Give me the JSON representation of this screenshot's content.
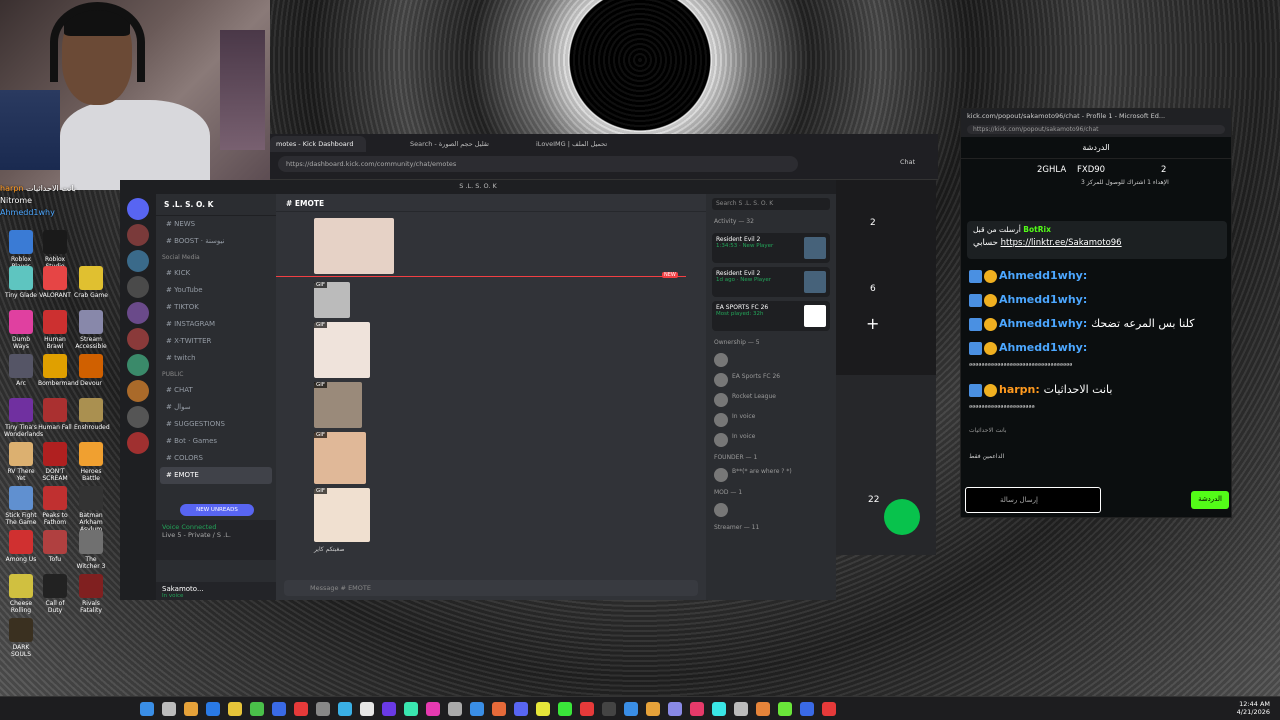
{
  "overlay_chat": {
    "rows": [
      {
        "user": "harpn",
        "text": "بانت الاحداثيات"
      },
      {
        "user": "",
        "text": "Nitrome"
      },
      {
        "user": "",
        "text": "Ahmedd1why"
      }
    ]
  },
  "desktop_icons": [
    {
      "label": "Roblox Player",
      "color": "#3a7bd5"
    },
    {
      "label": "Roblox Studio",
      "color": "#1a1a1a"
    },
    {
      "label": "Tiny Glade",
      "color": "#5ec5c0"
    },
    {
      "label": "VALORANT",
      "color": "#e64545"
    },
    {
      "label": "Crab Game",
      "color": "#e0c030"
    },
    {
      "label": "Dumb Ways",
      "color": "#e040a0"
    },
    {
      "label": "Human Brawl",
      "color": "#cc3030"
    },
    {
      "label": "Stream Accessible",
      "color": "#8888aa"
    },
    {
      "label": "Arc",
      "color": "#555566"
    },
    {
      "label": "Bombermand",
      "color": "#e0a000"
    },
    {
      "label": "Devour",
      "color": "#d06000"
    },
    {
      "label": "Tiny Tina's Wonderlands",
      "color": "#7030a0"
    },
    {
      "label": "Human Fall",
      "color": "#aa3030"
    },
    {
      "label": "Enshrouded",
      "color": "#aa9050"
    },
    {
      "label": "RV There Yet",
      "color": "#dcb070"
    },
    {
      "label": "DON'T SCREAM",
      "color": "#b02020"
    },
    {
      "label": "Heroes Battle",
      "color": "#f0a030"
    },
    {
      "label": "Stick Fight The Game",
      "color": "#6090d0"
    },
    {
      "label": "Peaks to Fathom",
      "color": "#c03030"
    },
    {
      "label": "Batman Arkham Asylum",
      "color": "#333"
    },
    {
      "label": "Among Us",
      "color": "#d03030"
    },
    {
      "label": "Tofu",
      "color": "#b04040"
    },
    {
      "label": "The Witcher 3",
      "color": "#707070"
    },
    {
      "label": "Cheese Rolling",
      "color": "#d0c040"
    },
    {
      "label": "Call of Duty",
      "color": "#222"
    },
    {
      "label": "Rivals Fatality",
      "color": "#802020"
    },
    {
      "label": "DARK SOULS",
      "color": "#3a3020"
    }
  ],
  "browser": {
    "tabs": [
      "motes - Kick Dashboard",
      "Search - تقليل حجم الصورة",
      "iLoveIMG | تحميل الملف"
    ],
    "url": "https://dashboard.kick.com/community/chat/emotes",
    "chat_button": "Chat"
  },
  "discord": {
    "window_title": "S .L. S. O. K",
    "guild_name": "S .L. S. O. K",
    "channels": [
      {
        "name": "NEWS",
        "type": "ch"
      },
      {
        "name": "BOOST · نيوسنة",
        "type": "ch"
      },
      {
        "name": "Social Media",
        "type": "cat"
      },
      {
        "name": "KICK",
        "type": "ch"
      },
      {
        "name": "YouTube",
        "type": "ch"
      },
      {
        "name": "TIKTOK",
        "type": "ch"
      },
      {
        "name": "INSTAGRAM",
        "type": "ch"
      },
      {
        "name": "X-TWITTER",
        "type": "ch"
      },
      {
        "name": "twitch",
        "type": "ch"
      },
      {
        "name": "PUBLIC",
        "type": "cat"
      },
      {
        "name": "CHAT",
        "type": "ch"
      },
      {
        "name": "سوال",
        "type": "ch"
      },
      {
        "name": "SUGGESTIONS",
        "type": "ch"
      },
      {
        "name": "Bot · Games",
        "type": "ch"
      },
      {
        "name": "COLORS",
        "type": "ch"
      },
      {
        "name": "EMOTE",
        "type": "sel"
      }
    ],
    "new_unreads": "NEW UNREADS",
    "voice": {
      "status": "Voice Connected",
      "detail": "Live 5 - Private / S .L."
    },
    "user": {
      "name": "Sakamoto...",
      "status": "In voice"
    },
    "channel_title": "EMOTE",
    "search_placeholder": "Search S .L. S. O. K",
    "message_placeholder": "Message # EMOTE",
    "new_label": "NEW",
    "gif_label": "GIF",
    "gif_caption": "صغبتكم كاير",
    "activity": {
      "title": "Activity — 32",
      "cards": [
        {
          "game": "Resident Evil 2",
          "sub": "1:34:53 · New Player"
        },
        {
          "game": "Resident Evil 2",
          "sub": "1d ago · New Player"
        },
        {
          "game": "EA SPORTS FC 26",
          "sub": "Most played: 32h"
        }
      ]
    },
    "member_groups": [
      {
        "title": "Ownership — 5",
        "members": [
          "",
          "EA Sports FC 26",
          "Rocket League",
          "In voice",
          "In voice"
        ]
      },
      {
        "title": "FOUNDER — 1",
        "members": [
          "B**(* are where ? *)"
        ]
      },
      {
        "title": "MOD — 1",
        "members": [
          ""
        ]
      },
      {
        "title": "Streamer — 11",
        "members": []
      }
    ]
  },
  "kick_strip": {
    "numbers": [
      "2",
      "6",
      "22"
    ],
    "plus": "+"
  },
  "kickchat": {
    "title": "kick.com/popout/sakamoto96/chat - Profile 1 - Microsoft Ed...",
    "url": "https://kick.com/popout/sakamoto96/chat",
    "header": "الدردشة",
    "leaders": [
      {
        "name": "2GHLA",
        "count": "2"
      },
      {
        "name": "FXD90",
        "count": "2"
      }
    ],
    "leader_sub": "الإهداء 1 اشتراك للوصول للمركز 3",
    "pinned": {
      "by": "أرسلت من قبل",
      "user": "BotRix",
      "label": "حسابي",
      "link": "https://linktr.ee/Sakamoto96"
    },
    "messages": [
      {
        "user": "Ahmedd1why",
        "text": "",
        "orange": false
      },
      {
        "user": "Ahmedd1why",
        "text": "",
        "orange": false
      },
      {
        "user": "Ahmedd1why",
        "text": "كلنا بس المرعه تضحك",
        "orange": false
      },
      {
        "user": "Ahmedd1why",
        "text": "",
        "orange": false
      },
      {
        "user": "",
        "text": "ᵃᵃᵃᵃᵃᵃᵃᵃᵃᵃᵃᵃᵃᵃᵃᵃᵃᵃᵃᵃᵃᵃᵃᵃᵃᵃᵃᵃᵃᵃᵃᵃᵃ",
        "orange": false
      },
      {
        "user": "harpn",
        "text": "بانت الاحداثيات",
        "orange": true
      },
      {
        "user": "",
        "text": "ᵃᵃᵃᵃᵃᵃᵃᵃᵃᵃᵃᵃᵃᵃᵃᵃᵃᵃᵃᵃᵃ",
        "orange": false
      }
    ],
    "reply_hint": "بانت الاحداثيات",
    "supporters_label": "الداعمين فقط",
    "input_placeholder": "إرسال رسالة",
    "send_label": "الدردشة"
  },
  "taskbar": {
    "time": "12:44 AM",
    "date": "4/21/2026"
  }
}
